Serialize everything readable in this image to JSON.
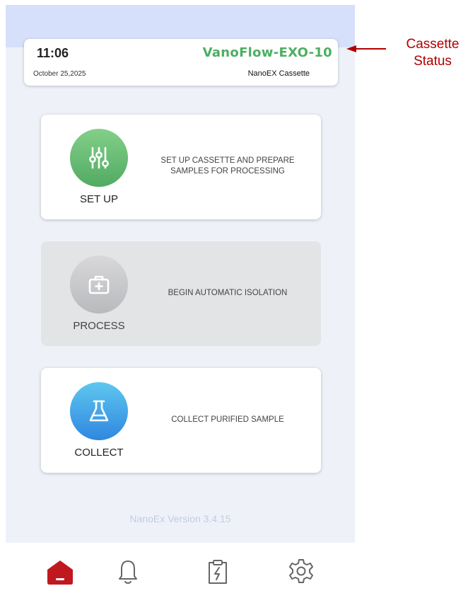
{
  "header": {
    "time": "11:06",
    "date": "October 25,2025",
    "device_name": "VanoFlow-EXO-10",
    "cassette_type": "NanoEX Cassette"
  },
  "cards": [
    {
      "title": "SET UP",
      "description": "SET UP CASSETTE AND PREPARE SAMPLES FOR PROCESSING",
      "icon": "sliders-icon",
      "color": "#5dbb6e",
      "enabled": true
    },
    {
      "title": "PROCESS",
      "description": "BEGIN AUTOMATIC ISOLATION",
      "icon": "medical-kit-icon",
      "color": "#c4c5c8",
      "enabled": false
    },
    {
      "title": "COLLECT",
      "description": "COLLECT PURIFIED SAMPLE",
      "icon": "flask-icon",
      "color": "#3a9de6",
      "enabled": true
    }
  ],
  "footer": {
    "version": "NanoEx Version 3.4.15"
  },
  "nav": [
    {
      "icon": "home-icon",
      "active": true,
      "color": "#c0181f"
    },
    {
      "icon": "bell-icon",
      "active": false
    },
    {
      "icon": "clipboard-bolt-icon",
      "active": false
    },
    {
      "icon": "gear-icon",
      "active": false
    }
  ],
  "annotation": {
    "line1": "Cassette",
    "line2": "Status",
    "color": "#b00000"
  }
}
